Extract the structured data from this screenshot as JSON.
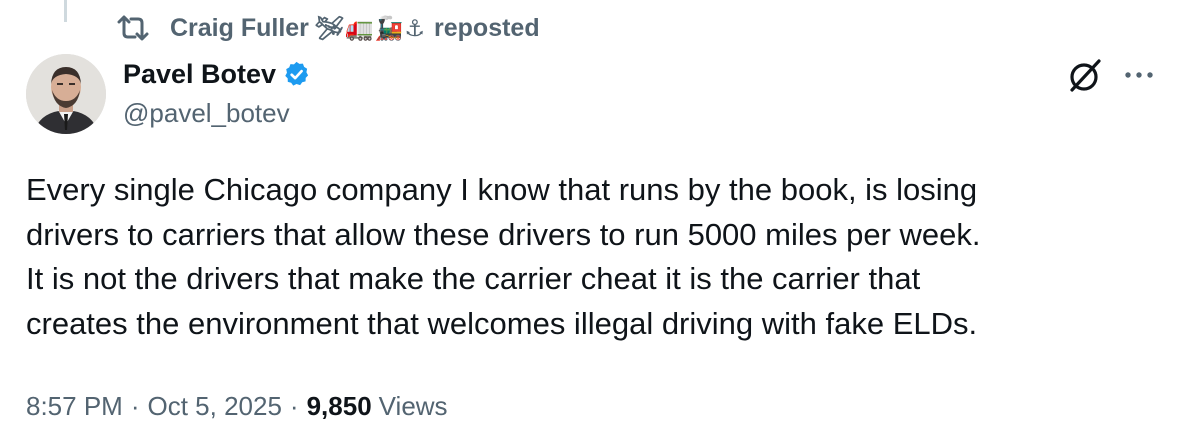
{
  "repost": {
    "user": "Craig Fuller",
    "emojis": "🛩🚛🚂⚓",
    "label": "reposted"
  },
  "author": {
    "name": "Pavel Botev",
    "handle": "@pavel_botev",
    "verified": true
  },
  "tweet": {
    "lines": [
      "Every single Chicago company I know that runs by the book, is losing",
      "drivers to carriers that allow these drivers to run 5000 miles per week.",
      "It is not the drivers that make the carrier cheat it is the carrier that",
      "creates the environment that welcomes illegal driving with fake ELDs."
    ]
  },
  "meta": {
    "time": "8:57 PM",
    "separator": "·",
    "date": "Oct 5, 2025",
    "views_count": "9,850",
    "views_label": "Views"
  },
  "icons": {
    "repost": "repost-icon",
    "verified": "verified-badge-icon",
    "grok": "grok-icon",
    "more": "more-options-icon"
  },
  "colors": {
    "text_primary": "#0f1419",
    "text_secondary": "#536471",
    "verified_blue": "#1d9bf0"
  }
}
